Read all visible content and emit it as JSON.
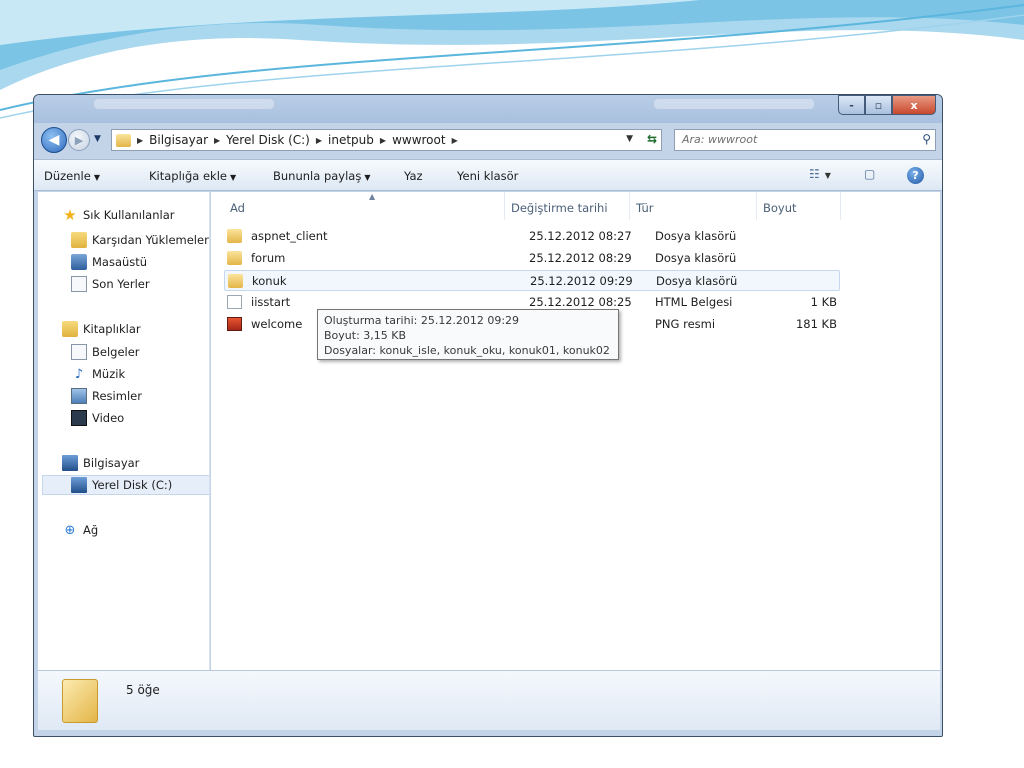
{
  "window": {
    "caption_buttons": {
      "minimize": "-",
      "maximize": "▫",
      "close": "x"
    }
  },
  "nav": {
    "back_icon": "arrow-left-icon",
    "forward_icon": "arrow-right-icon"
  },
  "address": {
    "crumbs": [
      "Bilgisayar",
      "Yerel Disk (C:)",
      "inetpub",
      "wwwroot"
    ],
    "search_placeholder": "Ara: wwwroot"
  },
  "commands": {
    "organize": "Düzenle",
    "add_to_library": "Kitaplığa ekle",
    "share_with": "Bununla paylaş",
    "burn": "Yaz",
    "new_folder": "Yeni klasör"
  },
  "sidebar": {
    "favorites": {
      "label": "Sık Kullanılanlar",
      "items": [
        "Karşıdan Yüklemeler",
        "Masaüstü",
        "Son Yerler"
      ]
    },
    "libraries": {
      "label": "Kitaplıklar",
      "items": [
        "Belgeler",
        "Müzik",
        "Resimler",
        "Video"
      ]
    },
    "computer": {
      "label": "Bilgisayar",
      "items": [
        "Yerel Disk (C:)"
      ],
      "selected": "Yerel Disk (C:)"
    },
    "network": {
      "label": "Ağ"
    }
  },
  "files": {
    "columns": [
      "Ad",
      "Değiştirme tarihi",
      "Tür",
      "Boyut"
    ],
    "rows": [
      {
        "name": "aspnet_client",
        "modified": "25.12.2012 08:27",
        "type": "Dosya klasörü",
        "size": "",
        "icon": "folder-icon"
      },
      {
        "name": "forum",
        "modified": "25.12.2012 08:29",
        "type": "Dosya klasörü",
        "size": "",
        "icon": "folder-icon"
      },
      {
        "name": "konuk",
        "modified": "25.12.2012 09:29",
        "type": "Dosya klasörü",
        "size": "",
        "icon": "folder-icon"
      },
      {
        "name": "iisstart",
        "modified": "25.12.2012 08:25",
        "type": "HTML Belgesi",
        "size": "1 KB",
        "icon": "html-file-icon"
      },
      {
        "name": "welcome",
        "modified": "",
        "type": "PNG resmi",
        "size": "181 KB",
        "icon": "png-file-icon"
      }
    ],
    "hovered": "konuk"
  },
  "tooltip": {
    "line1": "Oluşturma tarihi: 25.12.2012 09:29",
    "line2": "Boyut: 3,15 KB",
    "line3": "Dosyalar: konuk_isle, konuk_oku, konuk01, konuk02"
  },
  "details": {
    "count": "5 öğe"
  }
}
